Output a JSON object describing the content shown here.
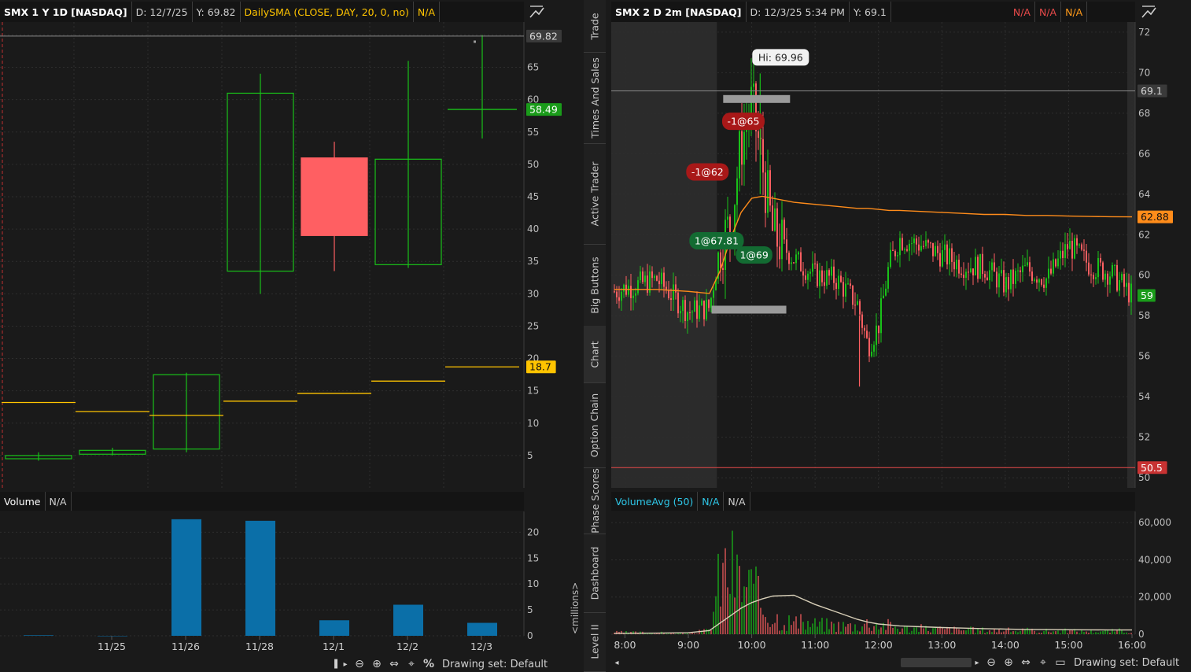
{
  "left_chart": {
    "header": {
      "symbol": "SMX 1 Y 1D [NASDAQ]",
      "date": "D: 12/7/25",
      "y_readout": "Y: 69.82",
      "study": "DailySMA (CLOSE, DAY, 20, 0, no)",
      "study_value": "N/A"
    },
    "price_axis_labels": [
      "70",
      "65",
      "60",
      "55",
      "50",
      "45",
      "40",
      "35",
      "30",
      "25",
      "20",
      "15",
      "10",
      "5"
    ],
    "last_price_badge": "58.49",
    "crosshair_badge": "69.82",
    "sma_badge": "18.7",
    "volume_header": {
      "label": "Volume",
      "value": "N/A"
    },
    "volume_axis_labels": [
      "20",
      "15",
      "10",
      "5",
      "0"
    ],
    "volume_units": "<millions>",
    "date_labels": [
      "11/25",
      "11/26",
      "11/28",
      "12/1",
      "12/2",
      "12/3"
    ],
    "drawing_set": "Drawing set: Default",
    "percent_symbol": "%"
  },
  "right_chart": {
    "header": {
      "symbol": "SMX 2 D 2m [NASDAQ]",
      "date": "D: 12/3/25 5:34 PM",
      "y_readout": "Y: 69.1",
      "na_1": "N/A",
      "na_2": "N/A",
      "na_3": "N/A"
    },
    "price_axis_labels": [
      "72",
      "70",
      "68",
      "66",
      "64",
      "62",
      "60",
      "58",
      "56",
      "54",
      "52",
      "50"
    ],
    "hi_callout": "Hi: 69.96",
    "crosshair_badge": "69.1",
    "vwap_badge": "62.88",
    "last_price_badge": "59",
    "low_line_badge": "50.5",
    "trade_labels": [
      "-1@65",
      "-1@62",
      "1@67.81",
      "1@69"
    ],
    "volume_header": {
      "label": "VolumeAvg (50)",
      "value_1": "N/A",
      "value_2": "N/A"
    },
    "volume_axis_labels": [
      "60,000",
      "40,000",
      "20,000",
      "0"
    ],
    "time_labels": [
      "8:00",
      "9:00",
      "10:00",
      "11:00",
      "12:00",
      "13:00",
      "14:00",
      "15:00",
      "16:00"
    ],
    "drawing_set": "Drawing set: Default"
  },
  "side_tabs": [
    "Trade",
    "Times And Sales",
    "Active Trader",
    "Big Buttons",
    "Chart",
    "Option Chain",
    "Phase Scores",
    "Dashboard",
    "Level II"
  ],
  "active_tab": "Chart",
  "colors": {
    "up": "#19c119",
    "down": "#ff5f62",
    "sma": "#ffc400",
    "vwap": "#ff8c1a",
    "volume_bar": "#0b6fa8",
    "vol_avg": "#d8cfb8",
    "bg": "#1a1a1a"
  },
  "chart_data": [
    {
      "type": "candlestick",
      "title": "SMX 1 Y 1D [NASDAQ]",
      "x": [
        "11/24",
        "11/25",
        "11/26",
        "11/28",
        "12/1",
        "12/2",
        "12/3"
      ],
      "open": [
        4.5,
        5.2,
        6.0,
        33.5,
        51.0,
        34.5,
        58.2
      ],
      "high": [
        5.5,
        6.2,
        17.8,
        64.0,
        53.5,
        66.0,
        70.0
      ],
      "low": [
        4.2,
        5.0,
        5.5,
        30.0,
        33.5,
        34.0,
        54.0
      ],
      "close": [
        5.0,
        5.8,
        17.5,
        61.0,
        39.0,
        50.8,
        58.49
      ],
      "sma20": [
        13.2,
        11.8,
        11.2,
        13.4,
        14.6,
        16.5,
        18.7
      ],
      "ylim": [
        0,
        72
      ],
      "volume_millions": [
        0.1,
        0.0,
        22.5,
        22.2,
        3.0,
        6.0,
        2.5
      ],
      "volume_ylim": [
        0,
        24
      ]
    },
    {
      "type": "line",
      "title": "SMX 2 D 2m [NASDAQ]",
      "x": [
        "7:50",
        "8:30",
        "9:00",
        "9:20",
        "9:30",
        "9:40",
        "9:50",
        "10:00",
        "10:10",
        "10:20",
        "10:40",
        "11:00",
        "11:20",
        "11:40",
        "11:50",
        "12:00",
        "12:10",
        "12:20",
        "12:40",
        "13:00",
        "13:20",
        "13:40",
        "14:00",
        "14:20",
        "14:40",
        "15:00",
        "15:20",
        "15:40",
        "16:00"
      ],
      "close": [
        59.2,
        59.8,
        58.2,
        58.4,
        61.5,
        62.5,
        66.5,
        68.5,
        65.5,
        62.0,
        60.8,
        60.0,
        59.8,
        58.6,
        56.5,
        57.5,
        60.5,
        61.8,
        61.5,
        61.0,
        60.5,
        60.4,
        59.5,
        60.3,
        59.8,
        61.5,
        60.5,
        60.1,
        59.0
      ],
      "vwap": [
        59.3,
        59.3,
        59.2,
        59.1,
        60.2,
        61.8,
        63.1,
        63.8,
        63.9,
        63.8,
        63.6,
        63.5,
        63.4,
        63.3,
        63.3,
        63.25,
        63.2,
        63.2,
        63.15,
        63.1,
        63.05,
        63.0,
        63.0,
        62.95,
        62.95,
        62.92,
        62.9,
        62.89,
        62.88
      ],
      "high_of_day": 69.96,
      "support_line": 50.5,
      "crosshair": 69.1,
      "ylim": [
        49.5,
        72.5
      ],
      "volume": [
        1500,
        1200,
        800,
        3000,
        45000,
        52000,
        38000,
        35000,
        22000,
        14000,
        9000,
        8000,
        7000,
        6500,
        9000,
        8000,
        7000,
        5000,
        4500,
        4000,
        3500,
        3200,
        3000,
        2800,
        2600,
        2500,
        2500,
        2400,
        3000
      ],
      "volume_avg": [
        500,
        600,
        800,
        2000,
        6000,
        10000,
        14000,
        17000,
        19000,
        20500,
        21000,
        16000,
        12000,
        8000,
        6500,
        5500,
        5000,
        4500,
        4000,
        3600,
        3300,
        3000,
        2800,
        2600,
        2500,
        2400,
        2350,
        2300,
        2300
      ],
      "volume_ylim": [
        0,
        66000
      ]
    }
  ]
}
